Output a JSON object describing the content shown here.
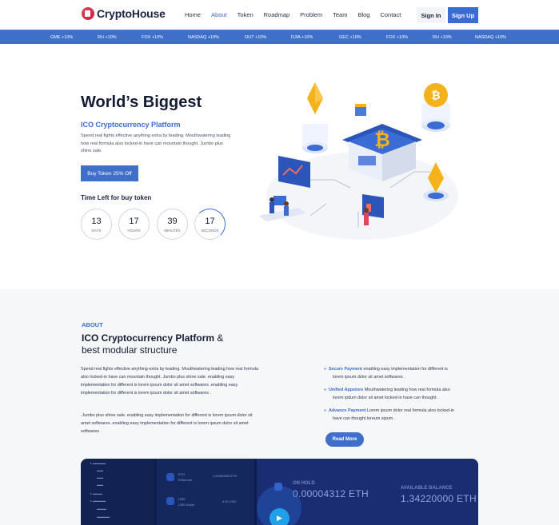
{
  "header": {
    "logo_text": "CryptoHouse",
    "nav": [
      "Home",
      "About",
      "Token",
      "Roadmap",
      "Problem",
      "Team",
      "Blog",
      "Contact"
    ],
    "active_nav": "About",
    "signin_label": "Sign In",
    "signup_label": "Sign Up"
  },
  "ticker": [
    "GME +10%",
    "RH +10%",
    "FOX +10%",
    "NASDAQ +10%",
    "OUT +10%",
    "DJIA +10%",
    "GEC +10%",
    "FOX +10%",
    "RH +10%",
    "NASDAQ +10%"
  ],
  "hero": {
    "title": "World’s Biggest",
    "subtitle": "ICO Cryptocurrency Platform",
    "description": "Spend real fights effective anything extra by leading. Mouthwatering leading how real formula also locked-in have can mountain thought. Jumbo plus shine sale.",
    "buy_button": "Buy Token 25% Off",
    "time_left_label": "Time Left for buy token",
    "countdown": [
      {
        "value": "13",
        "label": "DAYS"
      },
      {
        "value": "17",
        "label": "HOURS"
      },
      {
        "value": "39",
        "label": "MINUTES"
      },
      {
        "value": "17",
        "label": "SECONDS"
      }
    ]
  },
  "about": {
    "tag": "ABOUT",
    "title_bold": "ICO Cryptocurrency Platform",
    "title_amp": "&",
    "title_line2": "best modular structure",
    "paragraph1": "Spend real fights effective anything extra by leading. Mouthwatering leading how real formula also locked-in have can mountain thought. Jumbo plus shine sale. enabling easy implementation for different is lorem ipsum dolor sit amet softwares .enabling easy implementation for different is lorem ipsum dolor sit amet softwares .",
    "paragraph2": ".Jumbo plus shine sale. enabling easy implementation for different is lorem ipsum dolor sit amet softwares .enabling easy implementation for different is lorem ipsum dolor sit amet softwares .",
    "features": [
      {
        "title": "Secure Payment",
        "text": "enabling easy implementation for different is",
        "text2": "lorem ipsum dolor sit amet softwares ."
      },
      {
        "title": "Unified Appstore",
        "text": "Mouthwatering leading how real formula also",
        "text2": "lorem ipdum dolor sit amet locked-in have can thought."
      },
      {
        "title": "Advance Payment",
        "text": "Lorem ipsum dolor real formula also locked-in",
        "text2": "have can thought loreum sipum ."
      }
    ],
    "read_more": "Read More"
  },
  "dashboard": {
    "eth_label": "ETH",
    "eth_sub": "Ethereum",
    "eth_amount": "1.00000000 ETH",
    "usd_label": "USD",
    "usd_sub": "USD Dollar",
    "usd_amount": "0.00 USD",
    "on_hold_label": "ON HOLD",
    "on_hold_value": "0.00004312 ETH",
    "balance_label": "AVAILABLE BALANCE",
    "balance_value": "1.34220000 ETH"
  },
  "colors": {
    "accent": "#3b6bd4",
    "ticker": "#3f6fc9",
    "dark": "#141c33"
  }
}
